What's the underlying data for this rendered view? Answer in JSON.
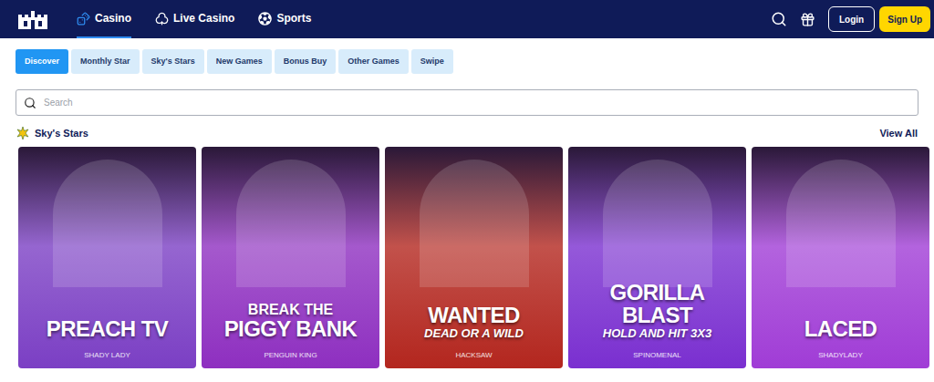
{
  "nav": {
    "items": [
      {
        "label": "Casino",
        "selected": true
      },
      {
        "label": "Live Casino",
        "selected": false
      },
      {
        "label": "Sports",
        "selected": false
      }
    ],
    "login": "Login",
    "signup": "Sign Up"
  },
  "filters": [
    {
      "label": "Discover",
      "selected": true
    },
    {
      "label": "Monthly Star",
      "selected": false
    },
    {
      "label": "Sky's Stars",
      "selected": false
    },
    {
      "label": "New Games",
      "selected": false
    },
    {
      "label": "Bonus Buy",
      "selected": false
    },
    {
      "label": "Other Games",
      "selected": false
    },
    {
      "label": "Swipe",
      "selected": false
    }
  ],
  "search": {
    "placeholder": "Search"
  },
  "section": {
    "title": "Sky's Stars",
    "view_all": "View All"
  },
  "games": [
    {
      "lines": [
        {
          "text": "PREACH TV",
          "kind": "big"
        }
      ],
      "provider": "SHADY LADY",
      "color": "#7b3fc4"
    },
    {
      "lines": [
        {
          "text": "BREAK THE",
          "kind": "medium"
        },
        {
          "text": "PIGGY BANK",
          "kind": "big"
        }
      ],
      "provider": "PENGUIN KING",
      "color": "#8e2fc0"
    },
    {
      "lines": [
        {
          "text": "WANTED",
          "kind": "big"
        },
        {
          "text": "DEAD OR A WILD",
          "kind": "small"
        }
      ],
      "provider": "HACKSAW",
      "color": "#b3261e"
    },
    {
      "lines": [
        {
          "text": "GORILLA BLAST",
          "kind": "big"
        },
        {
          "text": "HOLD AND HIT 3X3",
          "kind": "small"
        }
      ],
      "provider": "SPINOMENAL",
      "color": "#7a2fd0"
    },
    {
      "lines": [
        {
          "text": "LACED",
          "kind": "big"
        }
      ],
      "provider": "SHADYLADY",
      "color": "#a03cd6"
    }
  ]
}
